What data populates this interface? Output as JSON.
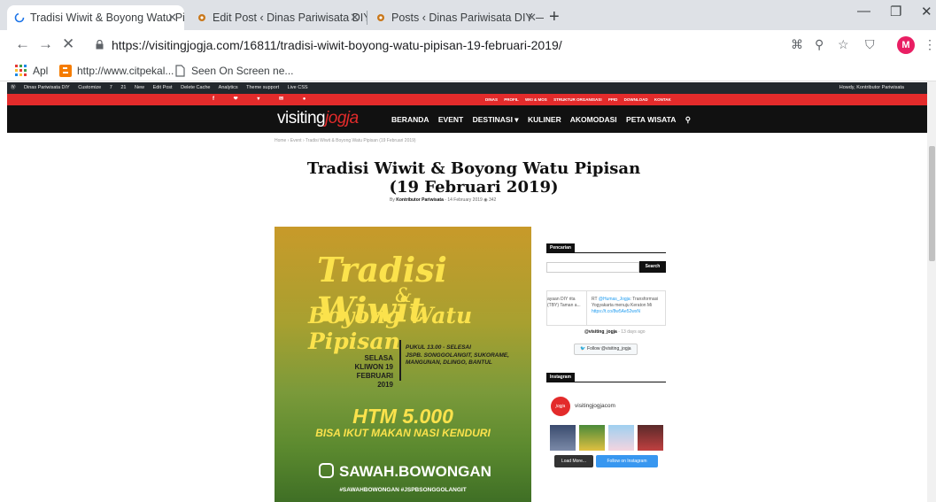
{
  "browser": {
    "tabs": [
      {
        "title": "Tradisi Wiwit & Boyong Watu Pip",
        "active": true
      },
      {
        "title": "Edit Post ‹ Dinas Pariwisata DIY –",
        "active": false
      },
      {
        "title": "Posts ‹ Dinas Pariwisata DIY — W",
        "active": false
      }
    ],
    "tab_close": "✕",
    "new_tab": "+",
    "url": "https://visitingjogja.com/16811/tradisi-wiwit-boyong-watu-pipisan-19-februari-2019/",
    "avatar_letter": "M",
    "bookmarks": [
      {
        "label": "Apl"
      },
      {
        "label": "http://www.citpekal..."
      },
      {
        "label": "Seen On Screen ne..."
      }
    ]
  },
  "wp_admin": {
    "items": [
      "Dinas Pariwisata DIY",
      "Customize",
      "7",
      "21",
      "New",
      "Edit Post",
      "Delete Cache",
      "Analytics",
      "Theme support",
      "Live CSS"
    ],
    "howdy": "Howdy, Kontributor Pariwisata"
  },
  "site": {
    "top_menu": [
      "DINAS",
      "PROFIL",
      "WKI & MOS",
      "STRUKTUR ORGANISASI",
      "PPID",
      "DOWNLOAD",
      "KONTAK"
    ],
    "logo_main": "visiting",
    "logo_accent": "jogja",
    "nav": [
      "BERANDA",
      "EVENT",
      "DESTINASI ▾",
      "KULINER",
      "AKOMODASI",
      "PETA WISATA"
    ],
    "breadcrumb": "Home › Event › Tradisi Wiwit & Boyong Watu Pipisan (19 Februari 2019)"
  },
  "post": {
    "title": "Tradisi Wiwit & Boyong Watu Pipisan (19 Februari 2019)",
    "author_prefix": "By",
    "author": "Kontributor Pariwisata",
    "date": "14 February 2019",
    "views": "342"
  },
  "poster": {
    "line1": "Tradisi Wiwit",
    "amp": "&",
    "line2": "Boyong Watu Pipisan",
    "day": "SELASA KLIWON 19 FEBRUARI 2019",
    "time": "PUKUL 13.00 - SELESAI\nJSPB. SONGGOLANGIT, SUKORAME,\nMANGUNAN, DLINGO, BANTUL",
    "htm": "HTM 5.000",
    "makan": "BISA IKUT MAKAN NASI KENDURI",
    "instagram": "SAWAH.BOWONGAN",
    "hashtags": "#SAWAHBOWONGAN #JSPBSONGGOLANGIT"
  },
  "sidebar": {
    "search_title": "Pencarian",
    "search_button": "Search",
    "tweet_left": "ayaan DIY rita (TBY) Taman a...",
    "tweet_right_prefix": "RT",
    "tweet_right_handle": "@Humas_Jogja",
    "tweet_right_text": ": Transformasi Yogyakarta menuju Keraton Mi",
    "tweet_right_link": "https://t.co/8w5Ae52wxN",
    "twitter_user": "@visiting_jogja",
    "twitter_time": "- 13 days ago",
    "follow_twitter": "Follow @visiting_jogja",
    "instagram_title": "Instagram",
    "instagram_user": "visitingjogjacom",
    "load_more": "Load More...",
    "follow_instagram": "Follow on Instagram"
  },
  "colors": {
    "accent_red": "#e32b2b",
    "nav_black": "#111111",
    "poster_yellow": "#fbe24c"
  }
}
